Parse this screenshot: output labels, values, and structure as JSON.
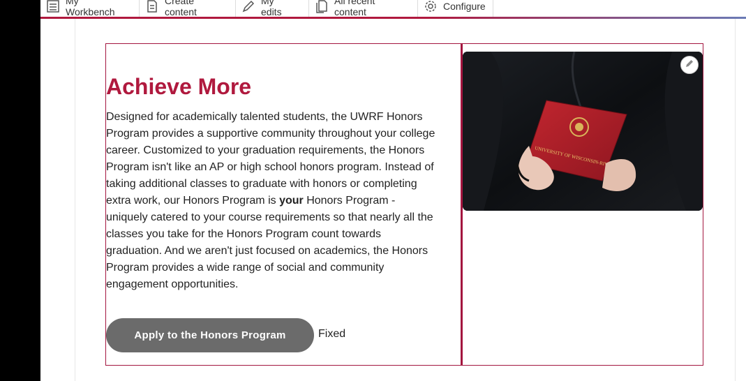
{
  "toolbar": {
    "items": [
      {
        "label": "My Workbench",
        "icon": "checklist-icon"
      },
      {
        "label": "Create content",
        "icon": "document-add-icon"
      },
      {
        "label": "My edits",
        "icon": "pencil-icon"
      },
      {
        "label": "All recent content",
        "icon": "documents-icon"
      },
      {
        "label": "Configure",
        "icon": "gear-icon"
      }
    ]
  },
  "content": {
    "heading": "Achieve More",
    "body_part1": "Designed for academically talented students, the UWRF Honors Program provides a supportive community throughout your college career. Customized to your graduation requirements, the Honors Program isn't like an AP or high school honors program. Instead of taking additional classes to graduate with honors or completing extra work, our Honors Program is ",
    "body_bold": "your",
    "body_part2": " Honors Program - uniquely catered to your course requirements so that nearly all the classes you take for the Honors Program count towards graduation. And we aren't just focused on academics, the Honors Program provides a wide range of social and community engagement opportunities.",
    "button_label": "Apply to the Honors Program",
    "button_suffix": "Fixed"
  },
  "image": {
    "folder_text": "UNIVERSITY OF WISCONSIN-RIVER FALLS",
    "edit_icon": "pencil-icon"
  },
  "colors": {
    "accent": "#b0193e",
    "button": "#6b6b6b",
    "folder": "#b0202c"
  }
}
